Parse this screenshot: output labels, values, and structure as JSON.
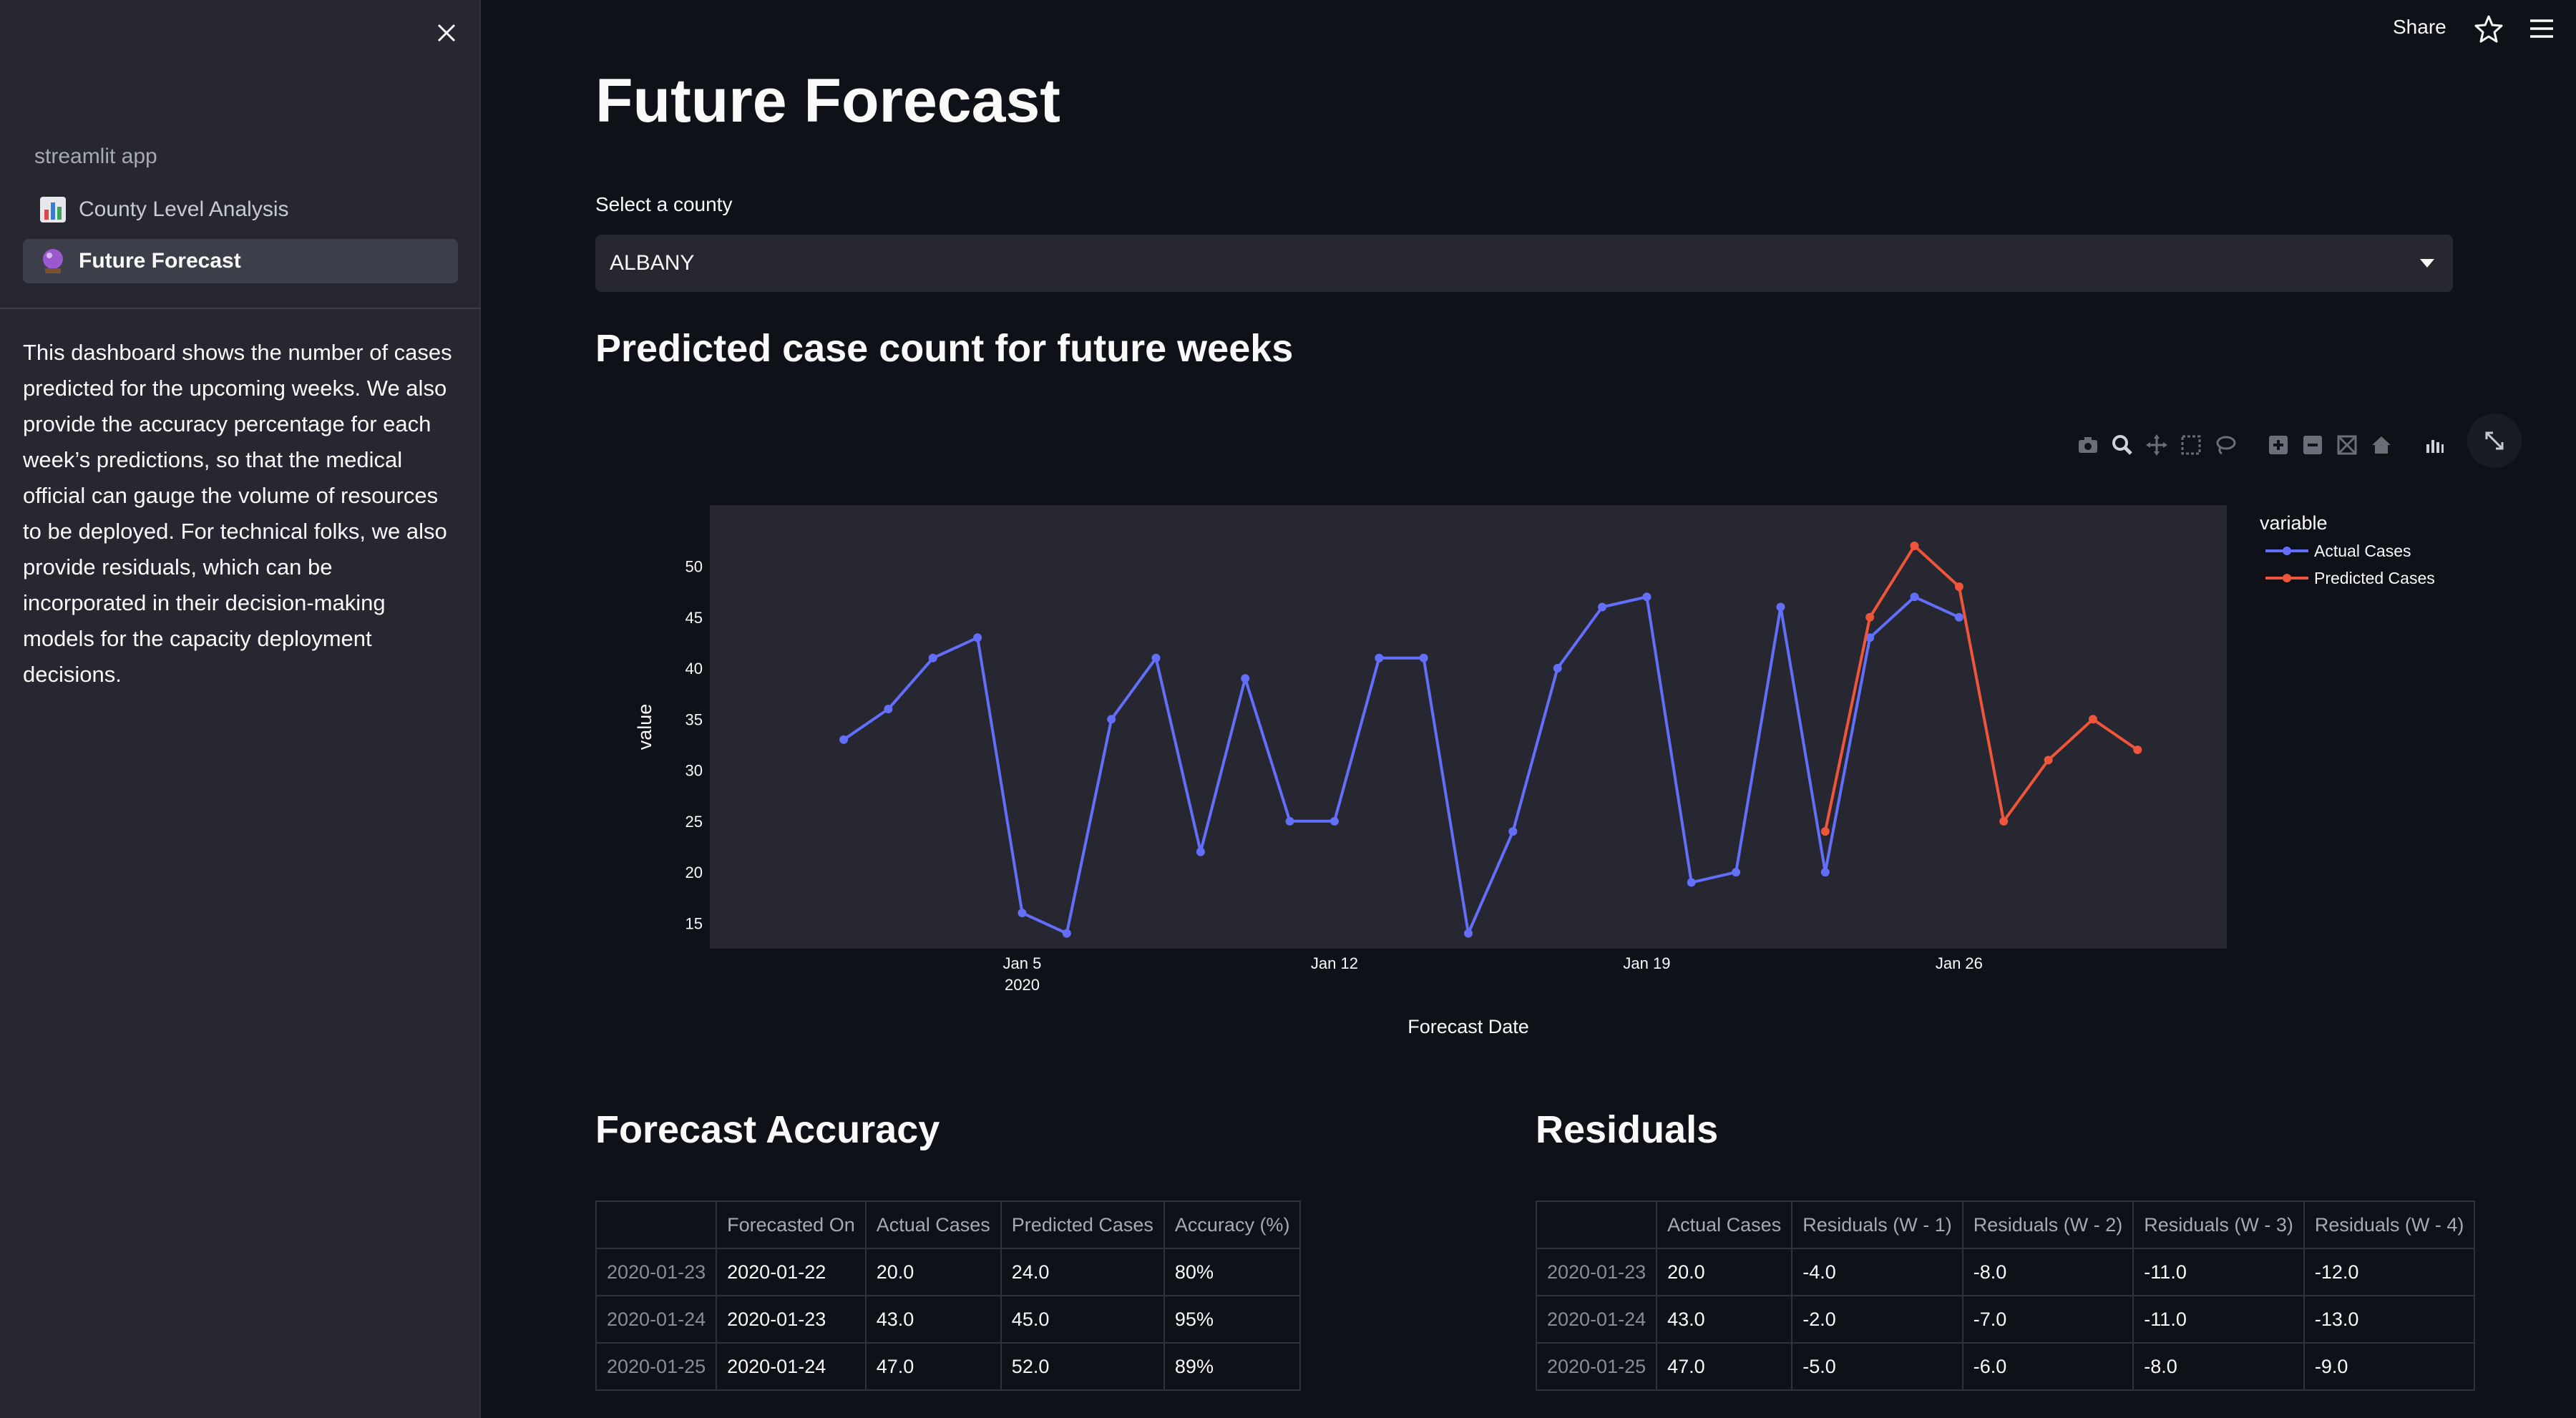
{
  "sidebar": {
    "app_name": "streamlit app",
    "nav": [
      {
        "label": "County Level Analysis",
        "icon": "bar-chart-icon"
      },
      {
        "label": "Future Forecast",
        "icon": "crystal-ball-icon"
      }
    ],
    "description": "This dashboard shows the number of cases predicted for the upcoming weeks. We also provide the accuracy percentage for each week’s predictions, so that the medical official can gauge the volume of resources to be deployed. For technical folks, we also provide residuals, which can be incorporated in their decision-making models for the capacity deployment decisions."
  },
  "header": {
    "share_label": "Share"
  },
  "main": {
    "title": "Future Forecast",
    "select_label": "Select a county",
    "selected_county": "ALBANY",
    "chart_heading": "Predicted case count for future weeks"
  },
  "colors": {
    "actual": "#636efa",
    "predicted": "#ef553b",
    "plot_bg": "#262730",
    "page_bg": "#0e1117"
  },
  "chart_data": {
    "type": "line",
    "xlabel": "Forecast Date",
    "ylabel": "value",
    "legend_title": "variable",
    "legend_position": "top-right",
    "grid": false,
    "x_ticks": [
      {
        "day": 5,
        "label": "Jan 5",
        "sublabel": "2020"
      },
      {
        "day": 12,
        "label": "Jan 12",
        "sublabel": ""
      },
      {
        "day": 19,
        "label": "Jan 19",
        "sublabel": ""
      },
      {
        "day": 26,
        "label": "Jan 26",
        "sublabel": ""
      }
    ],
    "y_ticks": [
      15,
      20,
      25,
      30,
      35,
      40,
      45,
      50
    ],
    "xlim": [
      "2019-12-29",
      "2020-02-01"
    ],
    "ylim": [
      12.5,
      56
    ],
    "series": [
      {
        "name": "Actual Cases",
        "x": [
          "2020-01-01",
          "2020-01-02",
          "2020-01-03",
          "2020-01-04",
          "2020-01-05",
          "2020-01-06",
          "2020-01-07",
          "2020-01-08",
          "2020-01-09",
          "2020-01-10",
          "2020-01-11",
          "2020-01-12",
          "2020-01-13",
          "2020-01-14",
          "2020-01-15",
          "2020-01-16",
          "2020-01-17",
          "2020-01-18",
          "2020-01-19",
          "2020-01-20",
          "2020-01-21",
          "2020-01-22",
          "2020-01-23",
          "2020-01-24",
          "2020-01-25",
          "2020-01-26"
        ],
        "y": [
          33,
          36,
          41,
          43,
          16,
          14,
          35,
          41,
          22,
          39,
          25,
          25,
          41,
          41,
          14,
          24,
          40,
          46,
          47,
          19,
          20,
          46,
          20,
          43,
          47,
          45
        ]
      },
      {
        "name": "Predicted Cases",
        "x": [
          "2020-01-23",
          "2020-01-24",
          "2020-01-25",
          "2020-01-26",
          "2020-01-27",
          "2020-01-28",
          "2020-01-29",
          "2020-01-30"
        ],
        "y": [
          24,
          45,
          52,
          48,
          25,
          31,
          35,
          32
        ]
      }
    ]
  },
  "accuracy": {
    "title": "Forecast Accuracy",
    "columns": [
      "",
      "Forecasted On",
      "Actual Cases",
      "Predicted Cases",
      "Accuracy (%)"
    ],
    "rows": [
      [
        "2020-01-23",
        "2020-01-22",
        "20.0",
        "24.0",
        "80%"
      ],
      [
        "2020-01-24",
        "2020-01-23",
        "43.0",
        "45.0",
        "95%"
      ],
      [
        "2020-01-25",
        "2020-01-24",
        "47.0",
        "52.0",
        "89%"
      ]
    ]
  },
  "residuals": {
    "title": "Residuals",
    "columns": [
      "",
      "Actual Cases",
      "Residuals (W - 1)",
      "Residuals (W - 2)",
      "Residuals (W - 3)",
      "Residuals (W - 4)"
    ],
    "rows": [
      [
        "2020-01-23",
        "20.0",
        "-4.0",
        "-8.0",
        "-11.0",
        "-12.0"
      ],
      [
        "2020-01-24",
        "43.0",
        "-2.0",
        "-7.0",
        "-11.0",
        "-13.0"
      ],
      [
        "2020-01-25",
        "47.0",
        "-5.0",
        "-6.0",
        "-8.0",
        "-9.0"
      ]
    ]
  }
}
